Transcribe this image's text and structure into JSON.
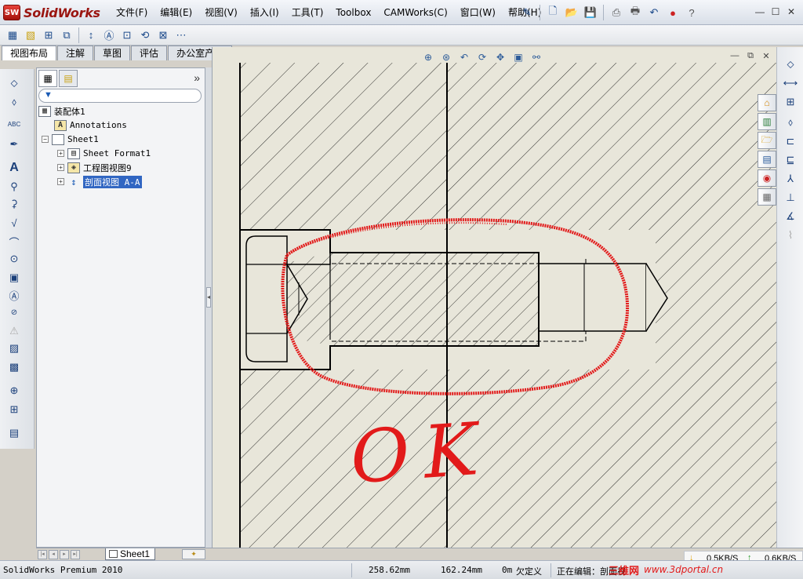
{
  "app": {
    "logo_mark": "SW",
    "logo_name": "SolidWorks"
  },
  "menu": [
    "文件(F)",
    "编辑(E)",
    "视图(V)",
    "插入(I)",
    "工具(T)",
    "Toolbox",
    "CAMWorks(C)",
    "窗口(W)",
    "帮助(H)"
  ],
  "command_tabs": [
    {
      "label": "视图布局",
      "active": true
    },
    {
      "label": "注解",
      "active": false
    },
    {
      "label": "草图",
      "active": false
    },
    {
      "label": "评估",
      "active": false
    },
    {
      "label": "办公室产品",
      "active": false
    }
  ],
  "feature_tree": {
    "root": "装配体1",
    "annotations": "Annotations",
    "sheet": "Sheet1",
    "sheet_format": "Sheet Format1",
    "drawing_view": "工程图视图9",
    "section_view": "剖面视图 A-A"
  },
  "annotation": {
    "handwritten_text": "OK"
  },
  "sheet_tab": {
    "label": "Sheet1"
  },
  "status": {
    "product": "SolidWorks Premium 2010",
    "x": "258.62mm",
    "y": "162.24mm",
    "z": "0m",
    "define_state": "欠定义",
    "editing": "正在编辑：剖面视"
  },
  "network": {
    "download": "0.5KB/S",
    "upload": "0.6KB/S"
  },
  "watermark": {
    "brand": "三维网",
    "url": "www.3dportal.cn"
  },
  "colors": {
    "selection": "#3166c2",
    "markup": "#e21a1a",
    "canvas": "#e8e6da"
  }
}
